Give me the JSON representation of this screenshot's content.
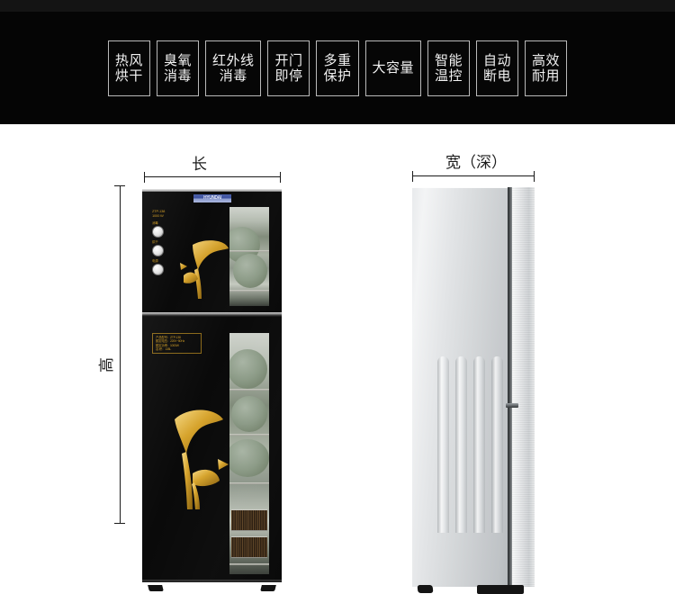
{
  "banner": {
    "background_color": "#050505",
    "badges": [
      {
        "name": "hot-air-drying",
        "lines": [
          "热风",
          "烘干"
        ]
      },
      {
        "name": "ozone-sterilization",
        "lines": [
          "臭氧",
          "消毒"
        ]
      },
      {
        "name": "infrared-sterilization",
        "lines": [
          "红外线",
          "消毒"
        ]
      },
      {
        "name": "door-open-auto-stop",
        "lines": [
          "开门",
          "即停"
        ]
      },
      {
        "name": "multiple-protection",
        "lines": [
          "多重",
          "保护"
        ]
      },
      {
        "name": "large-capacity",
        "lines": [
          "大容量"
        ]
      },
      {
        "name": "smart-temperature-control",
        "lines": [
          "智能",
          "温控"
        ]
      },
      {
        "name": "auto-power-off",
        "lines": [
          "自动",
          "断电"
        ]
      },
      {
        "name": "high-efficiency-durable",
        "lines": [
          "高效",
          "耐用"
        ]
      }
    ]
  },
  "diagram": {
    "labels": {
      "length": "长",
      "width_depth": "宽（深）",
      "height": "高"
    },
    "front_view": {
      "brand_logo_text": "HYUNDAI",
      "upper_cabinet": {
        "model_text": "ZTP-138",
        "power_text": "1000 W",
        "knobs": [
          {
            "caption": "消毒"
          },
          {
            "caption": "烘干"
          },
          {
            "caption": "电源"
          }
        ]
      },
      "lower_cabinet": {
        "spec_lines": [
          "产品型号：ZTP-138",
          "额定电压：220V~50Hz",
          "额定功率：1000W",
          "容    积：138L"
        ]
      }
    },
    "side_view": {
      "panel_color": "#dfe2e4",
      "groove_count": 4
    }
  },
  "colors": {
    "banner_bg": "#050505",
    "badge_border": "#b9b9b9",
    "badge_text": "#f2f2f2",
    "cabinet_black": "#0a0a0a",
    "decal_gold": "#c9961f",
    "logo_blue": "#3d51a0",
    "page_bg": "#ffffff",
    "dimension_line": "#1a1a1a"
  }
}
